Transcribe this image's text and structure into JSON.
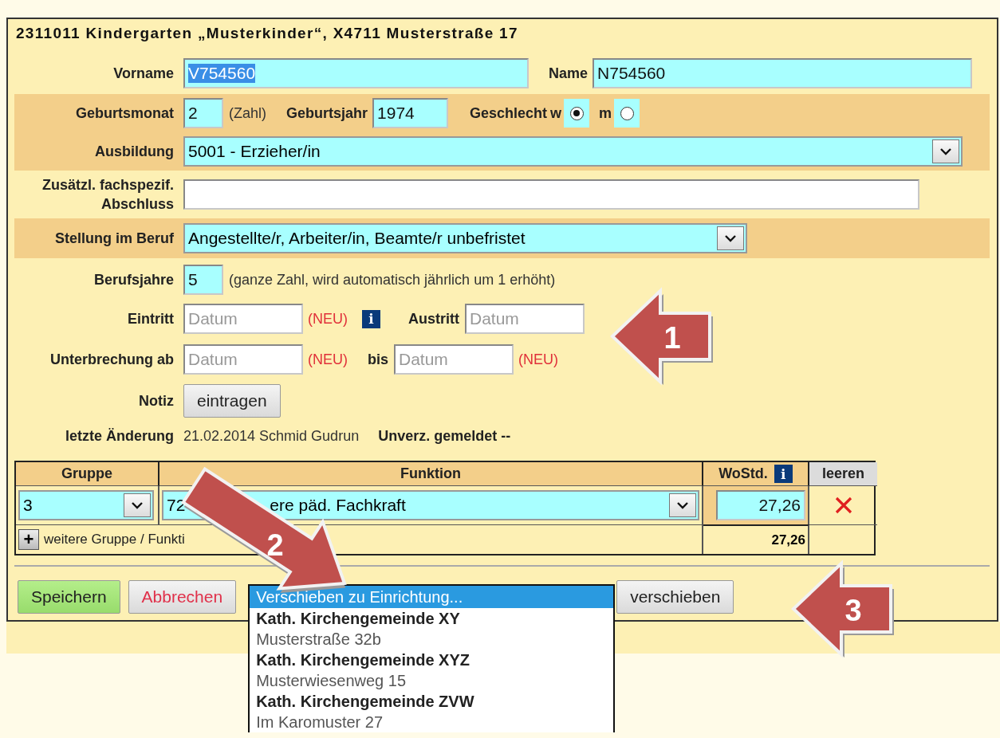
{
  "title": "2311011 Kindergarten „Musterkinder“, X4711 Musterstraße 17",
  "vorname": {
    "label": "Vorname",
    "value": "V754560",
    "text_selected": true
  },
  "name": {
    "label": "Name",
    "value": "N754560"
  },
  "geburtsmonat": {
    "label": "Geburtsmonat",
    "value": "2",
    "hint": "(Zahl)"
  },
  "geburtsjahr": {
    "label": "Geburtsjahr",
    "value": "1974"
  },
  "geschlecht": {
    "label": "Geschlecht",
    "options": [
      {
        "label": "w",
        "selected": true
      },
      {
        "label": "m",
        "selected": false
      }
    ]
  },
  "ausbildung": {
    "label": "Ausbildung",
    "value": "5001 - Erzieher/in"
  },
  "abschluss": {
    "label": "Zusätzl. fachspezif. Abschluss"
  },
  "stellung": {
    "label": "Stellung im Beruf",
    "value": "Angestellte/r, Arbeiter/in, Beamte/r unbefristet"
  },
  "berufsjahre": {
    "label": "Berufsjahre",
    "value": "5",
    "hint": "(ganze Zahl, wird automatisch jährlich um 1 erhöht)"
  },
  "eintritt": {
    "label": "Eintritt",
    "placeholder": "Datum",
    "badge": "(NEU)",
    "info": "i"
  },
  "austritt": {
    "label": "Austritt",
    "placeholder": "Datum"
  },
  "unterbrechung": {
    "label": "Unterbrechung ab",
    "placeholder": "Datum",
    "badge": "(NEU)"
  },
  "bis": {
    "label": "bis",
    "placeholder": "Datum",
    "badge": "(NEU)"
  },
  "notiz": {
    "label": "Notiz",
    "button": "eintragen"
  },
  "letzte_aenderung": {
    "label": "letzte Änderung",
    "value": "21.02.2014 Schmid Gudrun",
    "extra": "Unverz. gemeldet --"
  },
  "table": {
    "columns": [
      {
        "label": "Gruppe"
      },
      {
        "label": "Funktion"
      },
      {
        "label": "WoStd.",
        "info": "i"
      },
      {
        "label": "leeren"
      }
    ],
    "rows": [
      {
        "gruppe": "3",
        "funktion_start": "72",
        "funktion_end": "ere päd. Fachkraft",
        "wostd": "27,26"
      }
    ],
    "add": {
      "icon": "+",
      "label": "weitere Gruppe / Funkti"
    },
    "total": "27,26"
  },
  "actions": {
    "save": "Speichern",
    "cancel": "Abbrechen",
    "move": "verschieben",
    "dropdown": {
      "open": true,
      "options": [
        {
          "label": "Verschieben zu Einrichtung...",
          "kind": "prompt",
          "selected": true
        },
        {
          "label": "Kath. Kirchengemeinde XY",
          "kind": "heading",
          "selected": false
        },
        {
          "label": "Musterstraße 32b",
          "kind": "address",
          "selected": false
        },
        {
          "label": "Kath. Kirchengemeinde XYZ",
          "kind": "heading",
          "selected": false
        },
        {
          "label": "Musterwiesenweg 15",
          "kind": "address",
          "selected": false
        },
        {
          "label": "Kath. Kirchengemeinde ZVW",
          "kind": "heading",
          "selected": false
        },
        {
          "label": "Im Karomuster 27",
          "kind": "address",
          "selected": false
        }
      ]
    }
  },
  "callouts": [
    {
      "number": "1",
      "kind": "left"
    },
    {
      "number": "2",
      "kind": "diagonal"
    },
    {
      "number": "3",
      "kind": "left"
    }
  ]
}
